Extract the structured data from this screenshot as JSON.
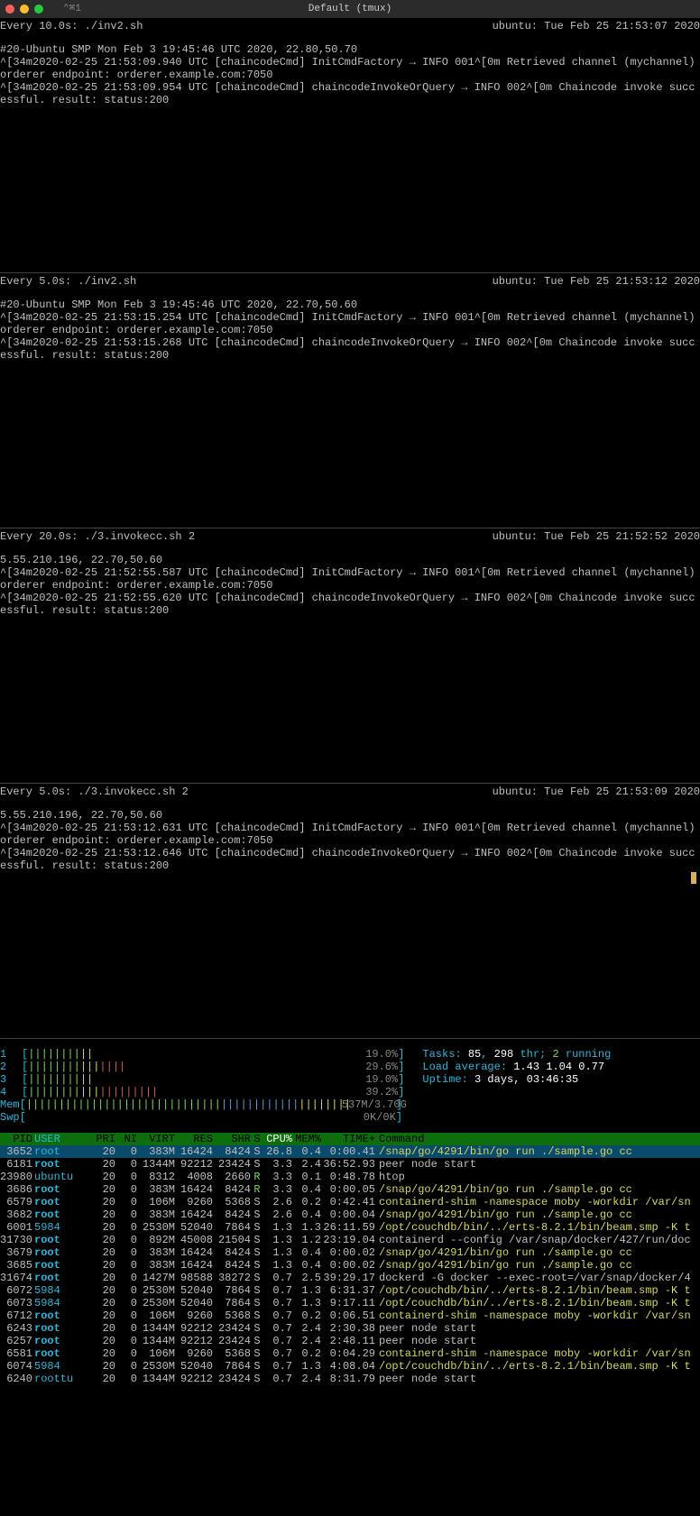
{
  "title": {
    "left": "⌃⌘1",
    "center": "Default (tmux)"
  },
  "panes": [
    {
      "head_left": "Every 10.0s: ./inv2.sh",
      "head_right": "ubuntu: Tue Feb 25 21:53:07 2020",
      "body": "#20-Ubuntu SMP Mon Feb 3 19:45:46 UTC 2020, 22.80,50.70\n^[34m2020-02-25 21:53:09.940 UTC [chaincodeCmd] InitCmdFactory → INFO 001^[0m Retrieved channel (mychannel) orderer endpoint: orderer.example.com:7050\n^[34m2020-02-25 21:53:09.954 UTC [chaincodeCmd] chaincodeInvokeOrQuery → INFO 002^[0m Chaincode invoke successful. result: status:200"
    },
    {
      "head_left": "Every 5.0s: ./inv2.sh",
      "head_right": "ubuntu: Tue Feb 25 21:53:12 2020",
      "body": "#20-Ubuntu SMP Mon Feb 3 19:45:46 UTC 2020, 22.70,50.60\n^[34m2020-02-25 21:53:15.254 UTC [chaincodeCmd] InitCmdFactory → INFO 001^[0m Retrieved channel (mychannel) orderer endpoint: orderer.example.com:7050\n^[34m2020-02-25 21:53:15.268 UTC [chaincodeCmd] chaincodeInvokeOrQuery → INFO 002^[0m Chaincode invoke successful. result: status:200"
    },
    {
      "head_left": "Every 20.0s: ./3.invokecc.sh 2",
      "head_right": "ubuntu: Tue Feb 25 21:52:52 2020",
      "body": "5.55.210.196, 22.70,50.60\n^[34m2020-02-25 21:52:55.587 UTC [chaincodeCmd] InitCmdFactory → INFO 001^[0m Retrieved channel (mychannel) orderer endpoint: orderer.example.com:7050\n^[34m2020-02-25 21:52:55.620 UTC [chaincodeCmd] chaincodeInvokeOrQuery → INFO 002^[0m Chaincode invoke successful. result: status:200"
    },
    {
      "head_left": "Every 5.0s: ./3.invokecc.sh 2",
      "head_right": "ubuntu: Tue Feb 25 21:53:09 2020",
      "body": "5.55.210.196, 22.70,50.60\n^[34m2020-02-25 21:53:12.631 UTC [chaincodeCmd] InitCmdFactory → INFO 001^[0m Retrieved channel (mychannel) orderer endpoint: orderer.example.com:7050\n^[34m2020-02-25 21:53:12.646 UTC [chaincodeCmd] chaincodeInvokeOrQuery → INFO 002^[0m Chaincode invoke successful. result: status:200"
    }
  ],
  "htop": {
    "cpus": [
      {
        "id": "1",
        "pct": "19.0%"
      },
      {
        "id": "2",
        "pct": "29.6%"
      },
      {
        "id": "3",
        "pct": "19.0%"
      },
      {
        "id": "4",
        "pct": "39.2%"
      }
    ],
    "mem": "537M/3.70G",
    "swp": "0K/0K",
    "tasks": "85",
    "threads": "298",
    "running": "2",
    "load": "1.43 1.04 0.77",
    "uptime": "3 days, 03:46:35",
    "hdr": [
      "PID",
      "USER",
      "PRI",
      "NI",
      "VIRT",
      "RES",
      "SHR",
      "S",
      "CPU%",
      "MEM%",
      "TIME+",
      "Command"
    ],
    "rows": [
      {
        "pid": "3652",
        "user": "root",
        "pri": "20",
        "ni": "0",
        "virt": "383M",
        "res": "16424",
        "shr": "8424",
        "s": "S",
        "cpu": "26.8",
        "mem": "0.4",
        "time": "0:00.41",
        "cmd": "/snap/go/4291/bin/go run ./sample.go cc",
        "ccls": "c-yellow",
        "sel": true
      },
      {
        "pid": "6181",
        "user": "root",
        "ub": true,
        "pri": "20",
        "ni": "0",
        "virt": "1344M",
        "res": "92212",
        "shr": "23424",
        "s": "S",
        "cpu": "3.3",
        "mem": "2.4",
        "time": "36:52.93",
        "cmd": "peer node start",
        "ccls": ""
      },
      {
        "pid": "23980",
        "user": "ubuntu",
        "pri": "20",
        "ni": "0",
        "virt": "8312",
        "res": "4008",
        "shr": "2660",
        "s": "R",
        "scls": "c-green",
        "cpu": "3.3",
        "mem": "0.1",
        "time": "0:48.78",
        "cmd": "htop",
        "ccls": ""
      },
      {
        "pid": "3686",
        "user": "root",
        "ub": true,
        "pri": "20",
        "ni": "0",
        "virt": "383M",
        "res": "16424",
        "shr": "8424",
        "s": "R",
        "scls": "c-green",
        "cpu": "3.3",
        "mem": "0.4",
        "time": "0:00.05",
        "cmd": "/snap/go/4291/bin/go run ./sample.go cc",
        "ccls": "c-yellow"
      },
      {
        "pid": "6579",
        "user": "root",
        "ub": true,
        "pri": "20",
        "ni": "0",
        "virt": "106M",
        "res": "9260",
        "shr": "5368",
        "s": "S",
        "cpu": "2.6",
        "mem": "0.2",
        "time": "0:42.41",
        "cmd": "containerd-shim -namespace moby -workdir /var/sn",
        "ccls": "c-yellow"
      },
      {
        "pid": "3682",
        "user": "root",
        "ub": true,
        "pri": "20",
        "ni": "0",
        "virt": "383M",
        "res": "16424",
        "shr": "8424",
        "s": "S",
        "cpu": "2.6",
        "mem": "0.4",
        "time": "0:00.04",
        "cmd": "/snap/go/4291/bin/go run ./sample.go cc",
        "ccls": "c-yellow"
      },
      {
        "pid": "6001",
        "user": "5984",
        "ucls": "c-dcyan",
        "pri": "20",
        "ni": "0",
        "virt": "2530M",
        "res": "52040",
        "shr": "7864",
        "s": "S",
        "cpu": "1.3",
        "mem": "1.3",
        "time": "26:11.59",
        "cmd": "/opt/couchdb/bin/../erts-8.2.1/bin/beam.smp -K t",
        "ccls": "c-yellow"
      },
      {
        "pid": "31730",
        "user": "root",
        "ub": true,
        "pri": "20",
        "ni": "0",
        "virt": "892M",
        "res": "45008",
        "shr": "21504",
        "s": "S",
        "cpu": "1.3",
        "mem": "1.2",
        "time": "23:19.04",
        "cmd": "containerd --config /var/snap/docker/427/run/doc",
        "ccls": ""
      },
      {
        "pid": "3679",
        "user": "root",
        "ub": true,
        "pri": "20",
        "ni": "0",
        "virt": "383M",
        "res": "16424",
        "shr": "8424",
        "s": "S",
        "cpu": "1.3",
        "mem": "0.4",
        "time": "0:00.02",
        "cmd": "/snap/go/4291/bin/go run ./sample.go cc",
        "ccls": "c-yellow"
      },
      {
        "pid": "3685",
        "user": "root",
        "ub": true,
        "pri": "20",
        "ni": "0",
        "virt": "383M",
        "res": "16424",
        "shr": "8424",
        "s": "S",
        "cpu": "1.3",
        "mem": "0.4",
        "time": "0:00.02",
        "cmd": "/snap/go/4291/bin/go run ./sample.go cc",
        "ccls": "c-yellow"
      },
      {
        "pid": "31674",
        "user": "root",
        "ub": true,
        "pri": "20",
        "ni": "0",
        "virt": "1427M",
        "res": "98588",
        "shr": "38272",
        "s": "S",
        "cpu": "0.7",
        "mem": "2.5",
        "time": "39:29.17",
        "cmd": "dockerd -G docker --exec-root=/var/snap/docker/4",
        "ccls": ""
      },
      {
        "pid": "6072",
        "user": "5984",
        "ucls": "c-dcyan",
        "pri": "20",
        "ni": "0",
        "virt": "2530M",
        "res": "52040",
        "shr": "7864",
        "s": "S",
        "cpu": "0.7",
        "mem": "1.3",
        "time": "6:31.37",
        "cmd": "/opt/couchdb/bin/../erts-8.2.1/bin/beam.smp -K t",
        "ccls": "c-yellow"
      },
      {
        "pid": "6073",
        "user": "5984",
        "ucls": "c-dcyan",
        "pri": "20",
        "ni": "0",
        "virt": "2530M",
        "res": "52040",
        "shr": "7864",
        "s": "S",
        "cpu": "0.7",
        "mem": "1.3",
        "time": "9:17.11",
        "cmd": "/opt/couchdb/bin/../erts-8.2.1/bin/beam.smp -K t",
        "ccls": "c-yellow"
      },
      {
        "pid": "6712",
        "user": "root",
        "ub": true,
        "pri": "20",
        "ni": "0",
        "virt": "106M",
        "res": "9260",
        "shr": "5368",
        "s": "S",
        "cpu": "0.7",
        "mem": "0.2",
        "time": "0:06.51",
        "cmd": "containerd-shim -namespace moby -workdir /var/sn",
        "ccls": "c-yellow"
      },
      {
        "pid": "6243",
        "user": "root",
        "ub": true,
        "pri": "20",
        "ni": "0",
        "virt": "1344M",
        "res": "92212",
        "shr": "23424",
        "s": "S",
        "cpu": "0.7",
        "mem": "2.4",
        "time": "2:30.38",
        "cmd": "peer node start",
        "ccls": ""
      },
      {
        "pid": "6257",
        "user": "root",
        "ub": true,
        "pri": "20",
        "ni": "0",
        "virt": "1344M",
        "res": "92212",
        "shr": "23424",
        "s": "S",
        "cpu": "0.7",
        "mem": "2.4",
        "time": "2:48.11",
        "cmd": "peer node start",
        "ccls": ""
      },
      {
        "pid": "6581",
        "user": "root",
        "ub": true,
        "pri": "20",
        "ni": "0",
        "virt": "106M",
        "res": "9260",
        "shr": "5368",
        "s": "S",
        "cpu": "0.7",
        "mem": "0.2",
        "time": "0:04.29",
        "cmd": "containerd-shim -namespace moby -workdir /var/sn",
        "ccls": "c-yellow"
      },
      {
        "pid": "6074",
        "user": "5984",
        "ucls": "c-dcyan",
        "pri": "20",
        "ni": "0",
        "virt": "2530M",
        "res": "52040",
        "shr": "7864",
        "s": "S",
        "cpu": "0.7",
        "mem": "1.3",
        "time": "4:08.04",
        "cmd": "/opt/couchdb/bin/../erts-8.2.1/bin/beam.smp -K t",
        "ccls": "c-yellow"
      },
      {
        "pid": "6240",
        "user": "roottu",
        "pri": "20",
        "ni": "0",
        "virt": "1344M",
        "res": "92212",
        "shr": "23424",
        "s": "S",
        "cpu": "0.7",
        "mem": "2.4",
        "time": "8:31.79",
        "cmd": "peer node start",
        "ccls": ""
      }
    ]
  }
}
